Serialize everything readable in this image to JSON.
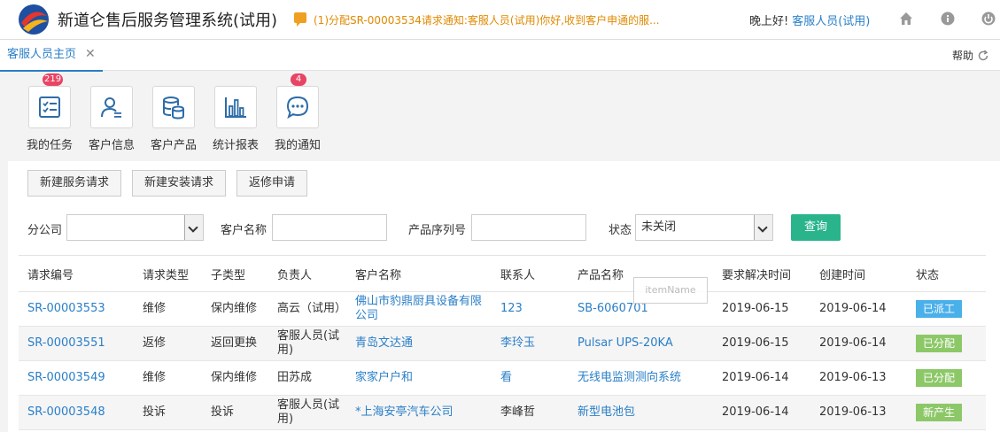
{
  "header": {
    "app_title": "新道仑售后服务管理系统(试用)",
    "notice": "(1)分配SR-00003534请求通知:客服人员(试用)你好,收到客户申通的服...",
    "greeting": "晚上好!",
    "user": "客服人员(试用)"
  },
  "tabs": {
    "home_tab": "客服人员主页",
    "help": "帮助"
  },
  "shortcuts": [
    {
      "label": "我的任务",
      "badge": "219"
    },
    {
      "label": "客户信息"
    },
    {
      "label": "客户产品"
    },
    {
      "label": "统计报表"
    },
    {
      "label": "我的通知",
      "badge": "4"
    }
  ],
  "actions": {
    "new_service": "新建服务请求",
    "new_install": "新建安装请求",
    "repair": "返修申请"
  },
  "filters": {
    "branch_label": "分公司",
    "branch_value": "",
    "customer_label": "客户名称",
    "customer_value": "",
    "serial_label": "产品序列号",
    "serial_value": "",
    "status_label": "状态",
    "status_value": "未关闭",
    "query": "查询"
  },
  "table": {
    "columns": [
      "请求编号",
      "请求类型",
      "子类型",
      "负责人",
      "客户名称",
      "联系人",
      "产品名称",
      "要求解决时间",
      "创建时间",
      "状态"
    ],
    "rows": [
      [
        "SR-00003553",
        "维修",
        "保内维修",
        "高云（试用）",
        "佛山市豹鼎厨具设备有限公司",
        "123",
        "SB-6060701",
        "2019-06-15",
        "2019-06-14",
        "已派工"
      ],
      [
        "SR-00003551",
        "返修",
        "返回更换",
        "客服人员(试用)",
        "青岛文达通",
        "李玲玉",
        "Pulsar UPS-20KA",
        "2019-06-15",
        "2019-06-14",
        "已分配"
      ],
      [
        "SR-00003549",
        "维修",
        "保内维修",
        "田苏成",
        "家家户户和",
        "看",
        "无线电监测测向系统",
        "2019-06-14",
        "2019-06-13",
        "已分配"
      ],
      [
        "SR-00003548",
        "投诉",
        "投诉",
        "客服人员(试用)",
        "*上海安亭汽车公司",
        "李峰哲",
        "新型电池包",
        "2019-06-14",
        "2019-06-13",
        "新产生"
      ]
    ]
  },
  "drag_ghost": "itemName",
  "colors": {
    "primary": "#2a7fc8",
    "query": "#29b48c",
    "status_dispatched": "#4ab0ea",
    "status_assigned": "#8dc868",
    "badge": "#e84464"
  }
}
